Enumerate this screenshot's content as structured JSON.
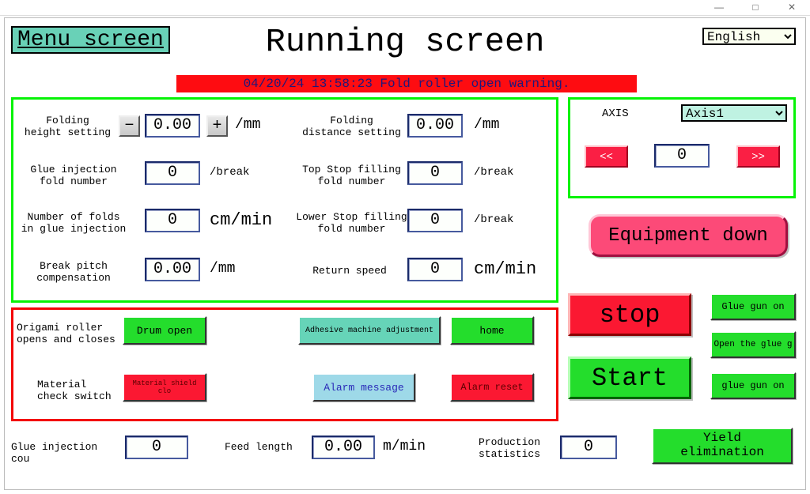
{
  "window": {
    "dash": "—",
    "square": "□",
    "close": "✕"
  },
  "header": {
    "menu_label": "Menu screen",
    "title": "Running screen",
    "language": "English"
  },
  "alarm_bar": "04/20/24  13:58:23  Fold roller open warning.",
  "settings": {
    "fold_height": {
      "label": "Folding\nheight setting",
      "value": "0.00",
      "unit": "/mm"
    },
    "fold_distance": {
      "label": "Folding\ndistance setting",
      "value": "0.00",
      "unit": "/mm"
    },
    "glue_fold_num": {
      "label": "Glue injection\nfold number",
      "value": "0",
      "unit": "/break"
    },
    "top_stop": {
      "label": "Top Stop filling\nfold number",
      "value": "0",
      "unit": "/break"
    },
    "num_folds": {
      "label": "Number of folds\nin glue injection",
      "value": "0",
      "unit": "cm/min"
    },
    "lower_stop": {
      "label": "Lower Stop filling\nfold number",
      "value": "0",
      "unit": "/break"
    },
    "break_pitch": {
      "label": "Break pitch\ncompensation",
      "value": "0.00",
      "unit": "/mm"
    },
    "return_speed": {
      "label": "Return speed",
      "value": "0",
      "unit": "cm/min"
    }
  },
  "controls": {
    "origami_label": "Origami roller\nopens and closes",
    "drum_open": "Drum open",
    "adhesive": "Adhesive machine adjustment",
    "home": "home",
    "material_label": "Material\ncheck switch",
    "material_shield": "Material shield clo",
    "alarm_msg": "Alarm message",
    "alarm_reset": "Alarm reset"
  },
  "axis": {
    "label": "AXIS",
    "selected": "Axis1",
    "value": "0",
    "prev": "<<",
    "next": ">>"
  },
  "right": {
    "equipment_down": "Equipment down",
    "stop": "stop",
    "start": "Start",
    "glue_gun_on": "Glue gun on",
    "open_glue": "Open the glue g",
    "glue_gun_on2": "glue gun on"
  },
  "footer": {
    "glue_cou": {
      "label": "Glue injection cou",
      "value": "0"
    },
    "feed_len": {
      "label": "Feed length",
      "value": "0.00",
      "unit": "m/min"
    },
    "prod_stats": {
      "label": "Production\nstatistics",
      "value": "0"
    },
    "yield_elim": "Yield\nelimination"
  }
}
